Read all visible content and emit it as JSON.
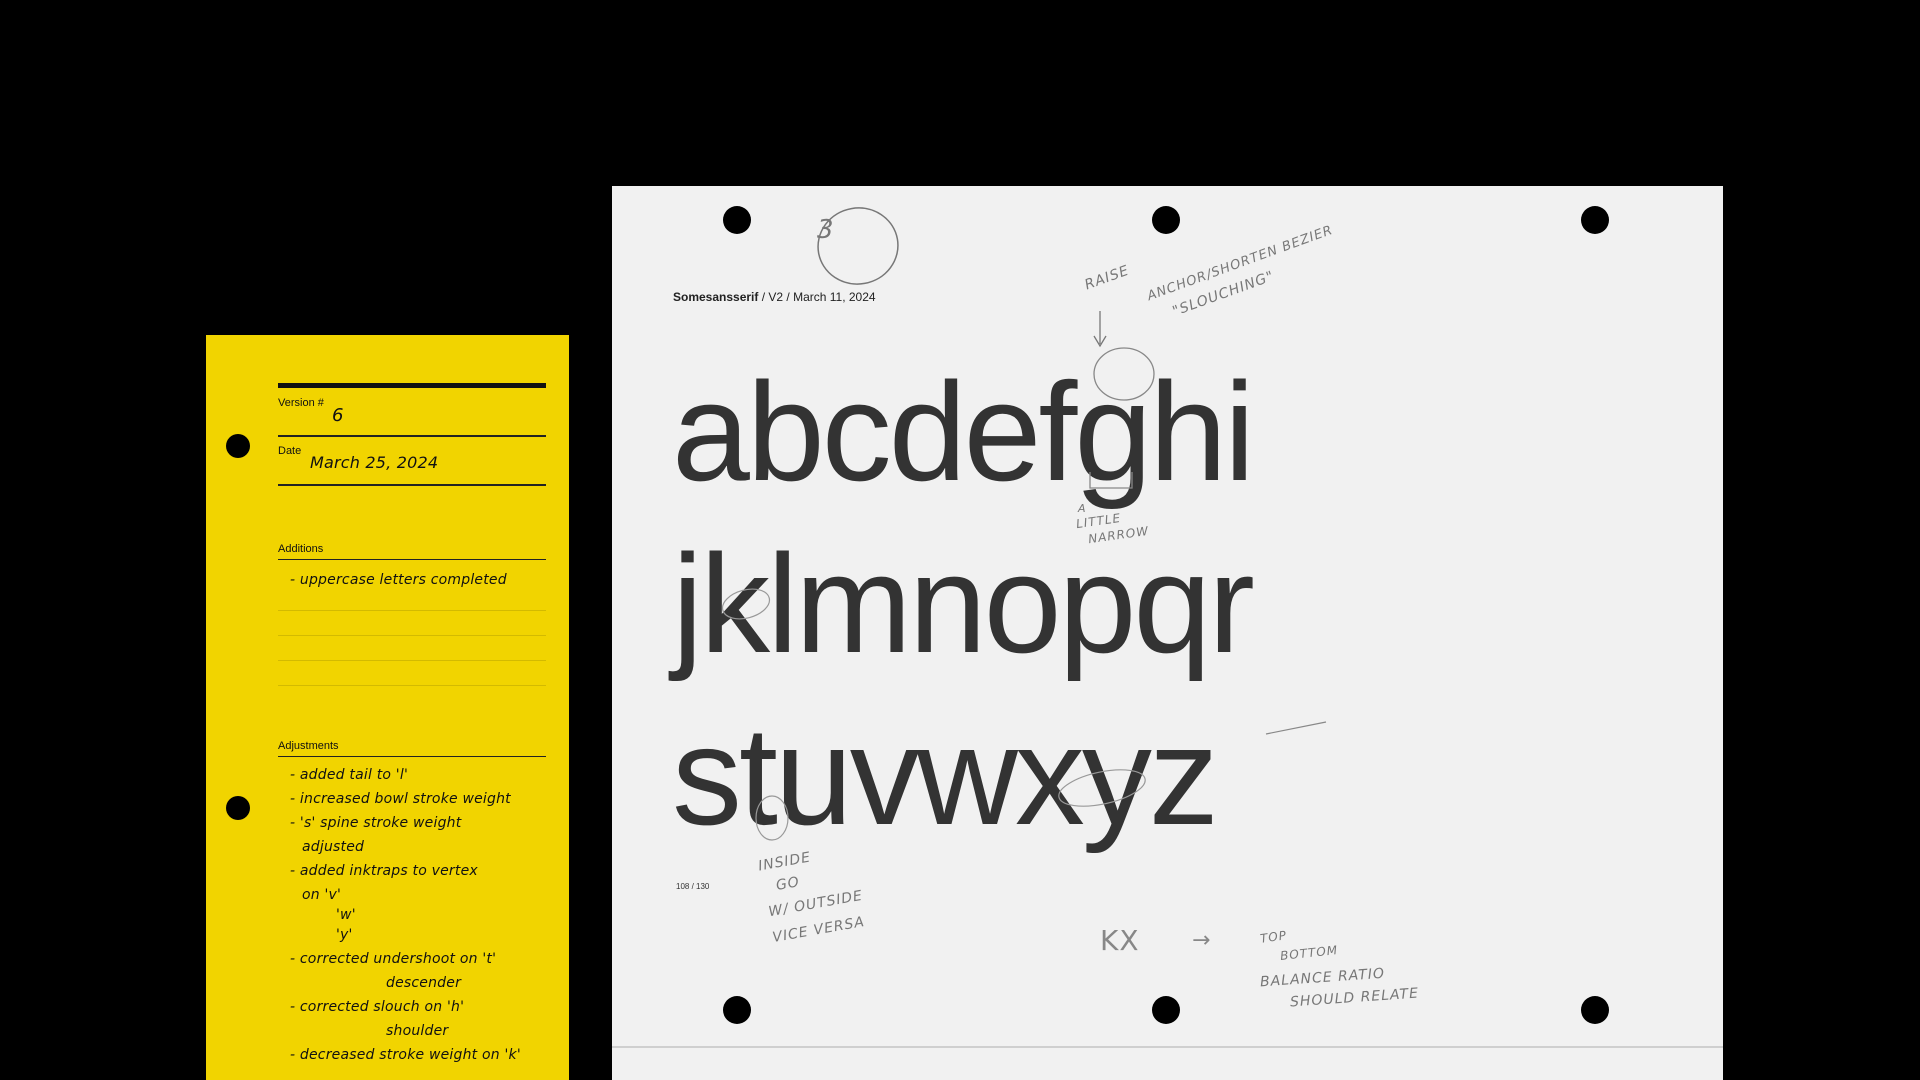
{
  "card": {
    "version_label": "Version #",
    "version_value": "6",
    "date_label": "Date",
    "date_value": "March 25, 2024",
    "additions_label": "Additions",
    "additions_items": [
      "- uppercase letters completed"
    ],
    "adjustments_label": "Adjustments",
    "adjustments_lines": [
      "- added tail to 'l'",
      "- increased bowl stroke weight",
      "- 's' spine stroke weight",
      "  adjusted",
      "- added inktraps to vertex",
      "  on 'v'",
      "     'w'",
      "     'y'",
      "- corrected undershoot on 't'",
      "           descender",
      "- corrected slouch on 'h'",
      "           shoulder",
      "- decreased stroke weight on 'k'"
    ]
  },
  "sheet": {
    "header_name": "Somesansserif",
    "header_rest": " / V2 / March 11, 2024",
    "row1": "abcdefghi",
    "row2": "jklmnopqr",
    "row3": "stuvwxyz",
    "page_number": "108 / 130",
    "circle_number": "3",
    "note_raise": "RAISE",
    "note_anchor": "ANCHOR/SHORTEN BEZIER",
    "note_slouching": "\"SLOUCHING\"",
    "note_narrow_1": "A",
    "note_narrow_2": "LITTLE",
    "note_narrow_3": "NARROW",
    "note_inside_1": "INSIDE",
    "note_inside_2": "GO",
    "note_inside_3": "W/ OUTSIDE",
    "note_inside_4": "VICE VERSA",
    "note_kx": "KX",
    "note_arrow": "→",
    "note_top": "TOP",
    "note_bottom": "BOTTOM",
    "note_balance": "BALANCE RATIO",
    "note_should": "SHOULD RELATE"
  },
  "colors": {
    "background": "#000000",
    "card": "#f1d400",
    "sheet": "#f1f1f1",
    "type": "#333333"
  }
}
